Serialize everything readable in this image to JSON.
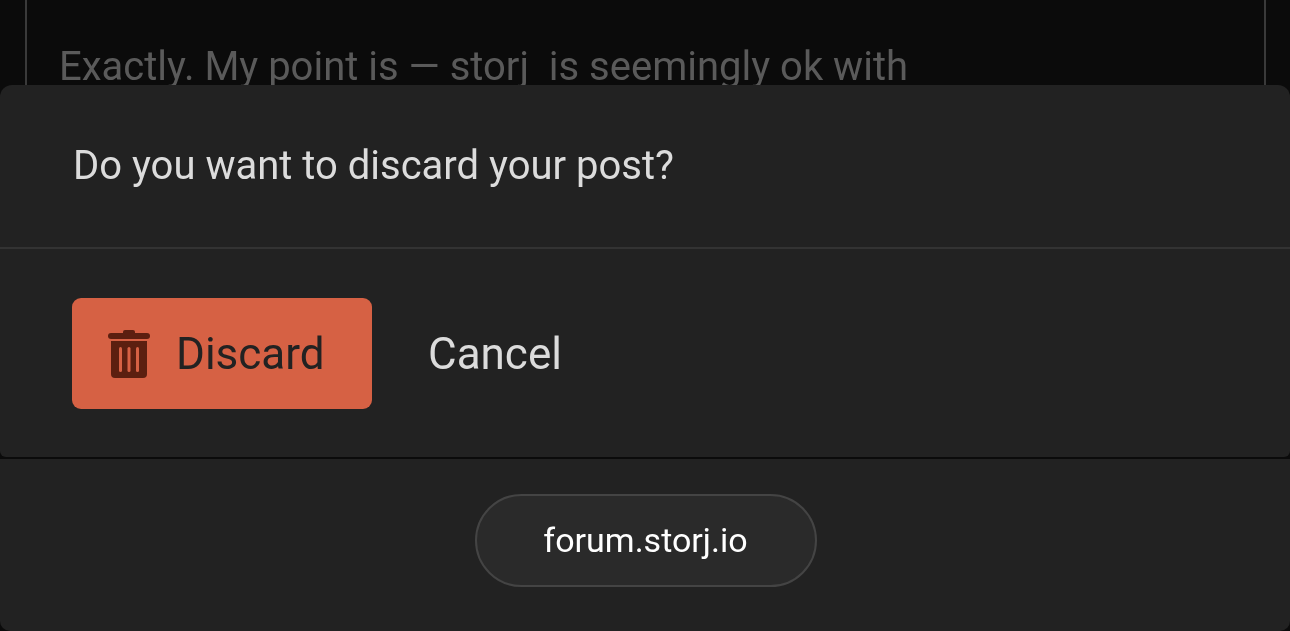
{
  "composer": {
    "text": "Exactly. My point is — storj  is seemingly ok with"
  },
  "dialog": {
    "title": "Do you want to discard your post?",
    "buttons": [
      {
        "kind": "danger",
        "label": "Discard"
      },
      {
        "kind": "plain",
        "label": "Cancel"
      }
    ]
  },
  "address_bar": {
    "url": "forum.storj.io"
  }
}
